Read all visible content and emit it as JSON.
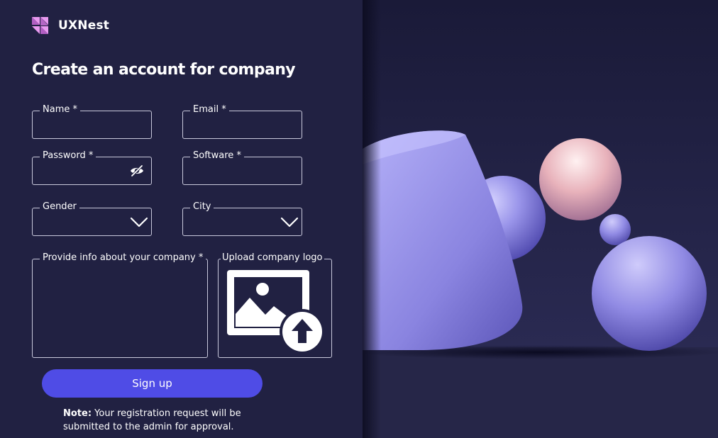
{
  "brand": {
    "name": "UXNest"
  },
  "form": {
    "title": "Create an account for company",
    "fields": {
      "name": {
        "label": "Name *",
        "value": ""
      },
      "email": {
        "label": "Email *",
        "value": ""
      },
      "password": {
        "label": "Password *",
        "value": ""
      },
      "software": {
        "label": "Software *",
        "value": ""
      },
      "gender": {
        "label": "Gender",
        "value": ""
      },
      "city": {
        "label": "City",
        "value": ""
      },
      "company_info": {
        "label": "Provide info about your company *",
        "value": ""
      },
      "upload_logo": {
        "label": "Upload company logo"
      }
    },
    "signup_label": "Sign up",
    "note": {
      "prefix": "Note:",
      "text": " Your registration request will be submitted to the admin for approval."
    }
  },
  "icons": {
    "brand": "uxnest-logo-icon",
    "password_toggle": "eye-off-icon",
    "dropdown": "chevron-down-icon",
    "upload": "image-upload-icon"
  },
  "colors": {
    "panel_background": "#212142",
    "primary_button": "#4f4ce6",
    "logo_accent": "#e99af0",
    "field_border": "#c9c9dc"
  }
}
